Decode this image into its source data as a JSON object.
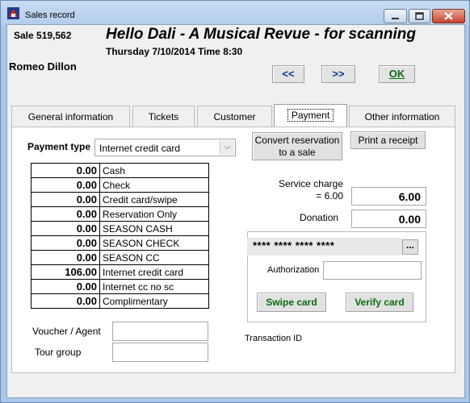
{
  "window": {
    "title": "Sales record"
  },
  "header": {
    "sale_number": "Sale 519,562",
    "show_title": "Hello Dali - A Musical Revue - for scanning",
    "performance": "Thursday 7/10/2014  Time 8:30",
    "customer_name": "Romeo Dillon"
  },
  "nav": {
    "prev_label": "<<",
    "next_label": ">>",
    "ok_label": "OK"
  },
  "tabs": [
    {
      "label": "General information",
      "active": false
    },
    {
      "label": "Tickets",
      "active": false
    },
    {
      "label": "Customer",
      "active": false
    },
    {
      "label": "Payment",
      "active": true
    },
    {
      "label": "Other information",
      "active": false
    }
  ],
  "payment": {
    "type_label": "Payment type",
    "type_value": "Internet credit card",
    "rows": [
      {
        "amount": "0.00",
        "method": "Cash"
      },
      {
        "amount": "0.00",
        "method": "Check"
      },
      {
        "amount": "0.00",
        "method": "Credit card/swipe"
      },
      {
        "amount": "0.00",
        "method": "Reservation Only"
      },
      {
        "amount": "0.00",
        "method": "SEASON CASH"
      },
      {
        "amount": "0.00",
        "method": "SEASON CHECK"
      },
      {
        "amount": "0.00",
        "method": "SEASON CC"
      },
      {
        "amount": "106.00",
        "method": "Internet credit card"
      },
      {
        "amount": "0.00",
        "method": "Internet cc no sc"
      },
      {
        "amount": "0.00",
        "method": "Complimentary"
      }
    ],
    "convert_label_line1": "Convert reservation",
    "convert_label_line2": "to a sale",
    "receipt_label": "Print a receipt",
    "service_charge_label": "Service charge",
    "service_charge_eq": "= 6.00",
    "service_charge_value": "6.00",
    "donation_label": "Donation",
    "donation_value": "0.00",
    "card_number": "**** **** **** ****",
    "card_more_label": "...",
    "authorization_label": "Authorization",
    "authorization_value": "",
    "swipe_label": "Swipe card",
    "verify_label": "Verify card",
    "transaction_id_label": "Transaction ID",
    "voucher_label": "Voucher / Agent",
    "voucher_value": "",
    "tour_group_label": "Tour group",
    "tour_group_value": ""
  },
  "colors": {
    "title_bar": "#b3cdea",
    "ok_green": "#0a6a10",
    "nav_blue": "#0a3c90",
    "close_red": "#c4452d"
  }
}
